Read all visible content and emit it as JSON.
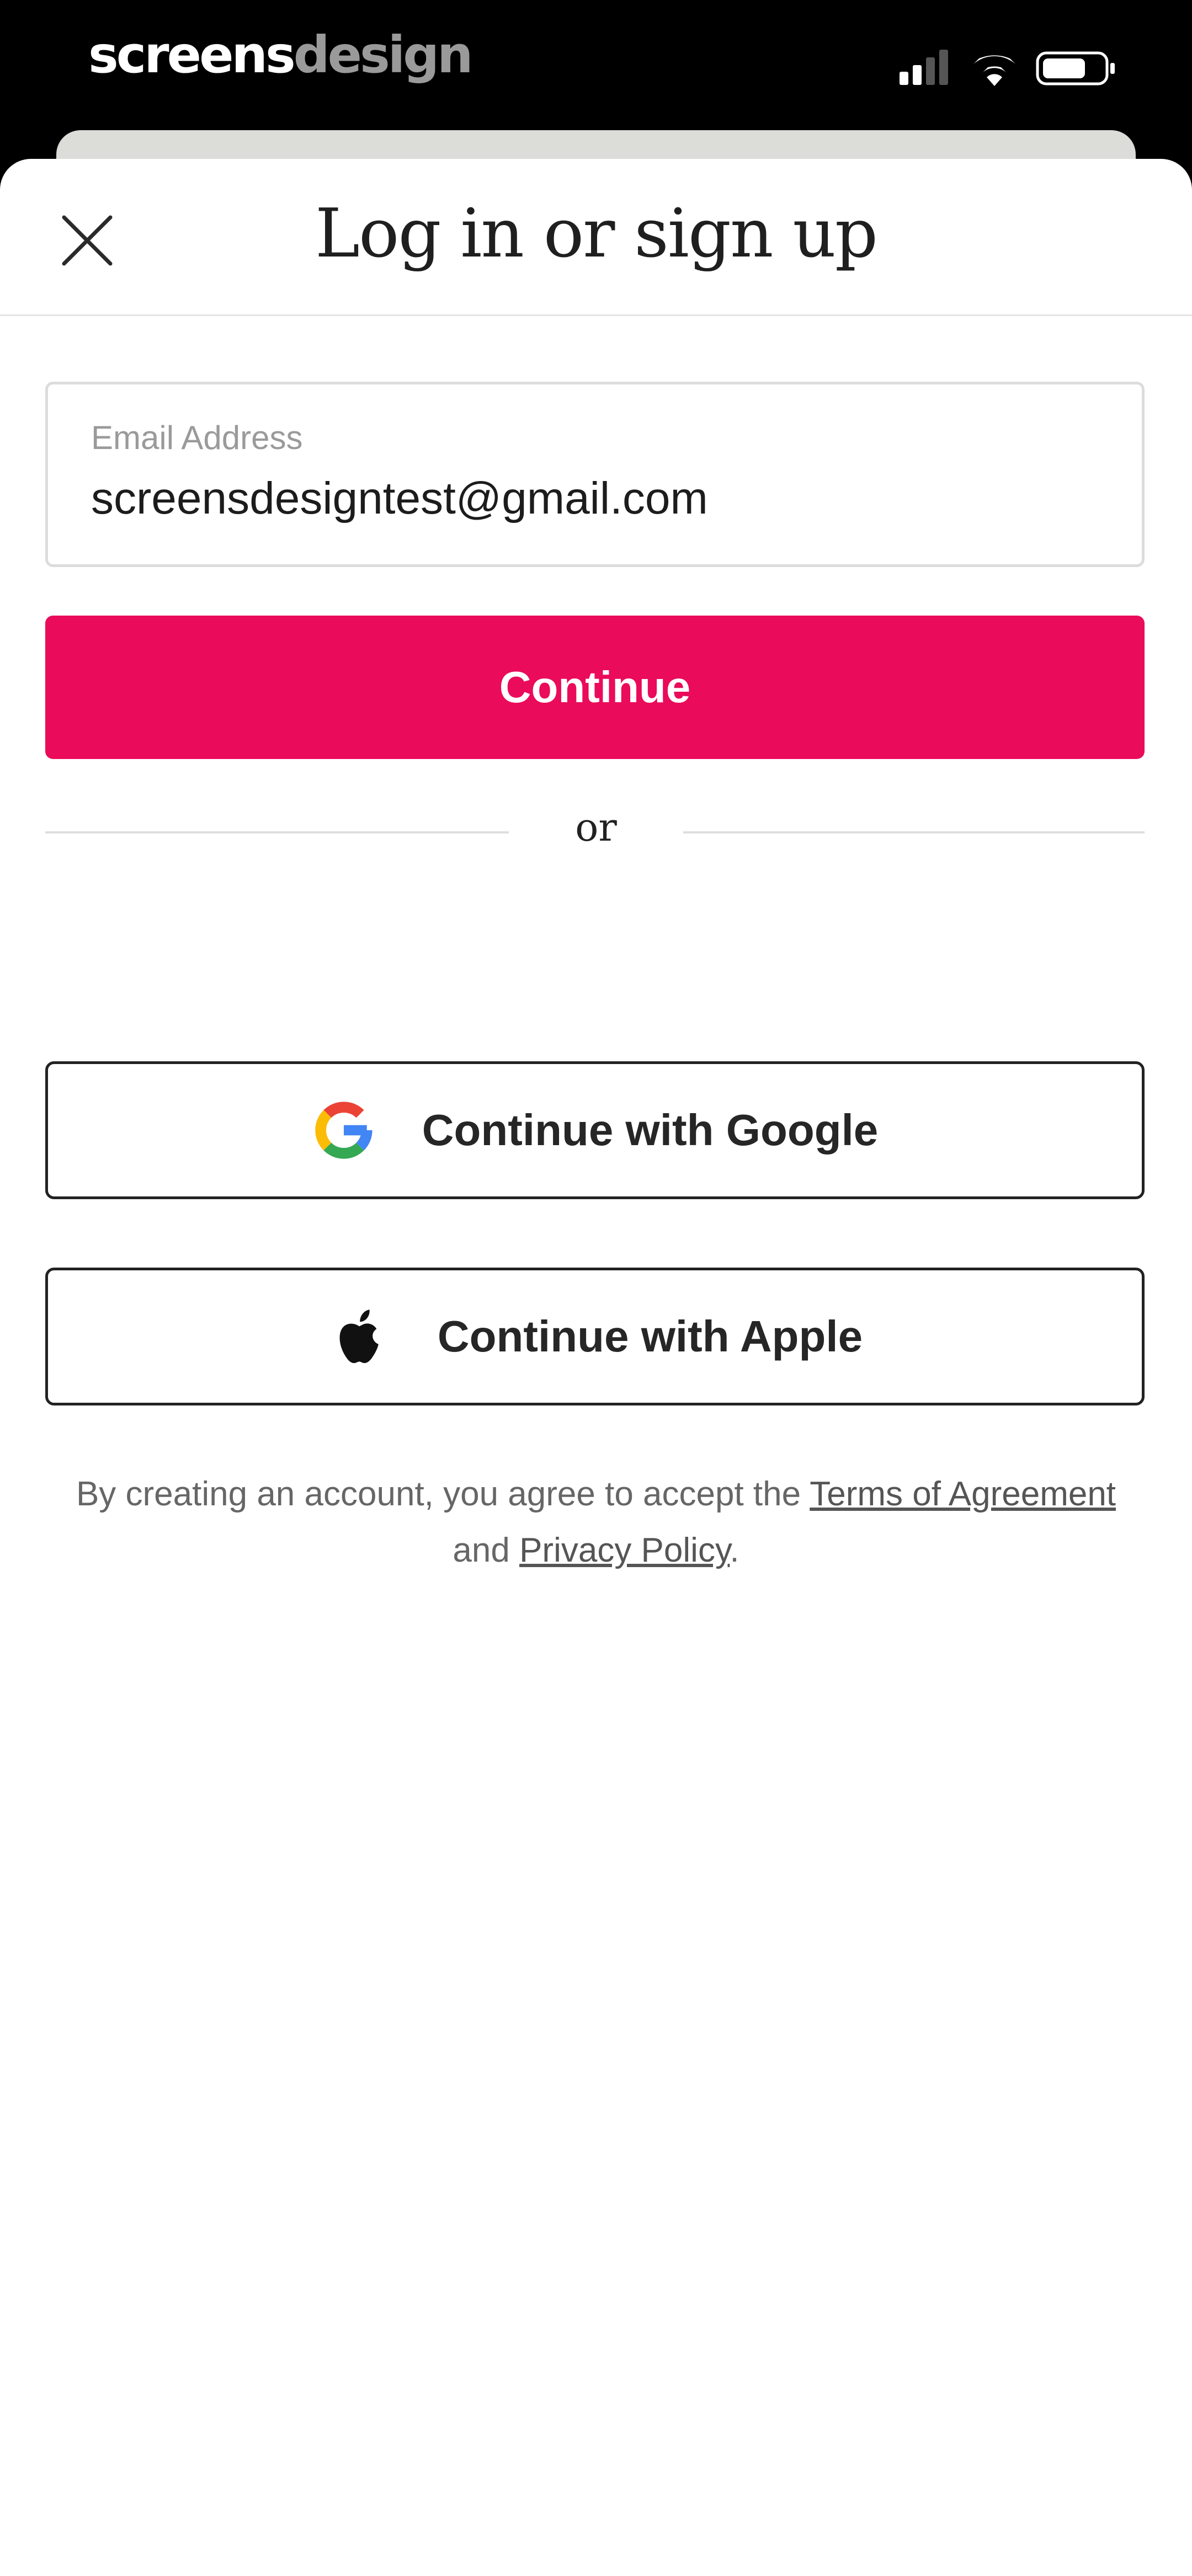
{
  "status_bar": {
    "brand_part1": "screens",
    "brand_part2": "design",
    "icons": [
      "cellular-signal-icon",
      "wifi-icon",
      "battery-icon"
    ]
  },
  "sheet": {
    "title": "Log in or sign up",
    "close_icon": "close-icon"
  },
  "email": {
    "label": "Email Address",
    "value": "screensdesigntest@gmail.com"
  },
  "continue_label": "Continue",
  "divider_text": "or",
  "social": {
    "google_label": "Continue with Google",
    "apple_label": "Continue with Apple"
  },
  "terms": {
    "prefix": "By creating an account, you agree to accept the ",
    "terms_link": "Terms of Agreement",
    "middle": " and ",
    "privacy_link": "Privacy Policy",
    "suffix": "."
  },
  "colors": {
    "accent": "#ea0b5a",
    "text_primary": "#1c1c1c",
    "text_muted": "#9a9a9a",
    "border": "#dcdcdc"
  }
}
